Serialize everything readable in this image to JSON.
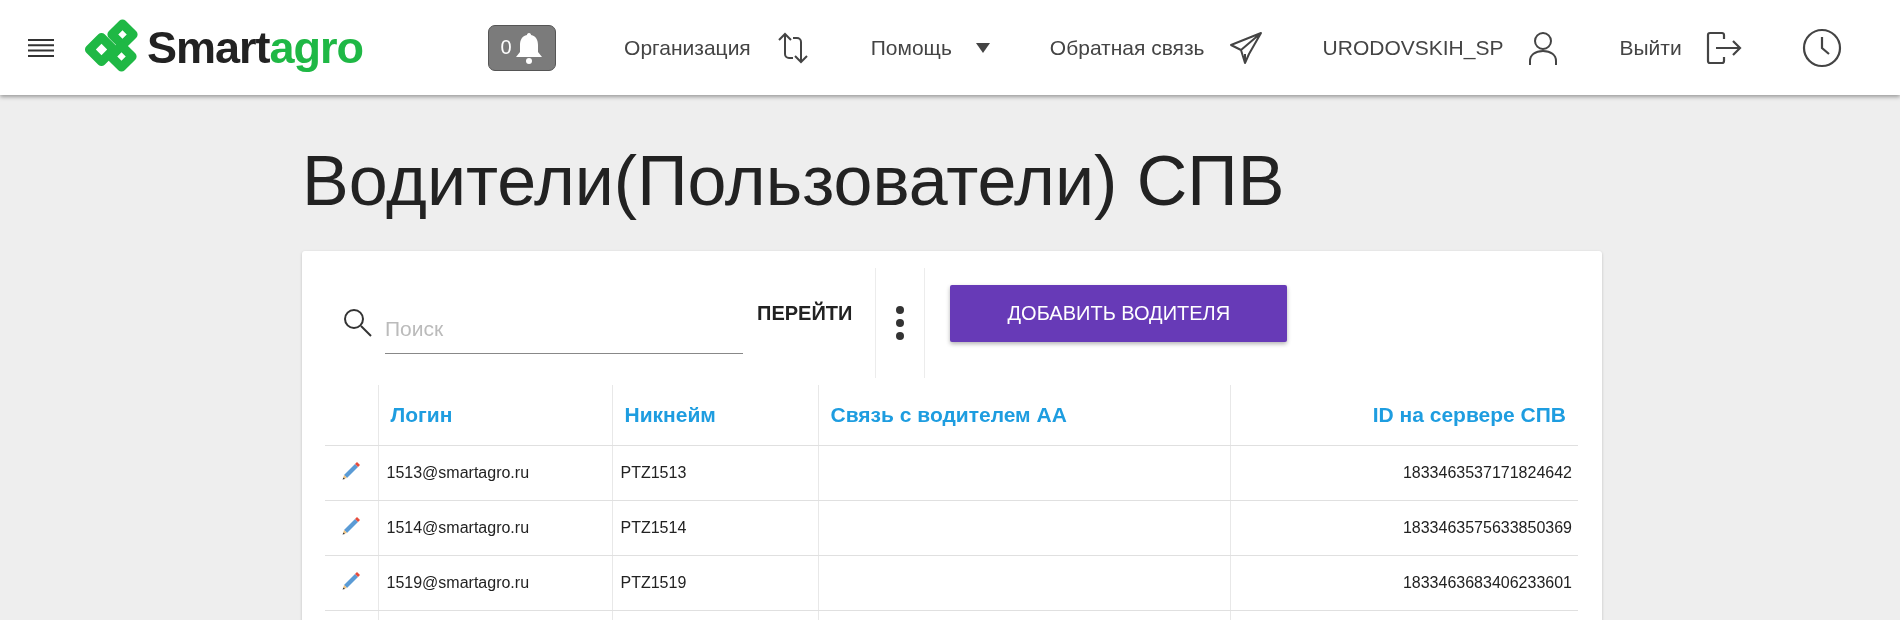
{
  "header": {
    "logo": {
      "dark": "Smart",
      "accent": "agro"
    },
    "notifications": {
      "count": "0"
    },
    "nav": [
      {
        "label": "Организация",
        "kind": "swap"
      },
      {
        "label": "Помощь",
        "kind": "dropdown"
      },
      {
        "label": "Обратная связь",
        "kind": "send"
      },
      {
        "label": "URODOVSKIH_SP",
        "kind": "user"
      },
      {
        "label": "Выйти",
        "kind": "logout"
      }
    ]
  },
  "title": "Водители(Пользователи) СПВ",
  "toolbar": {
    "search": {
      "placeholder": "Поиск"
    },
    "go_button": "ПЕРЕЙТИ",
    "add_button": "ДОБАВИТЬ ВОДИТЕЛЯ"
  },
  "table": {
    "columns": [
      "Логин",
      "Никнейм",
      "Связь с водителем АА",
      "ID на сервере СПВ"
    ],
    "rows": [
      {
        "login": "1513@smartagro.ru",
        "nickname": "PTZ1513",
        "server_id": "1833463537171824642"
      },
      {
        "login": "1514@smartagro.ru",
        "nickname": "PTZ1514",
        "server_id": "1833463575633850369"
      },
      {
        "login": "1519@smartagro.ru",
        "nickname": "PTZ1519",
        "server_id": "1833463683406233601"
      }
    ]
  }
}
